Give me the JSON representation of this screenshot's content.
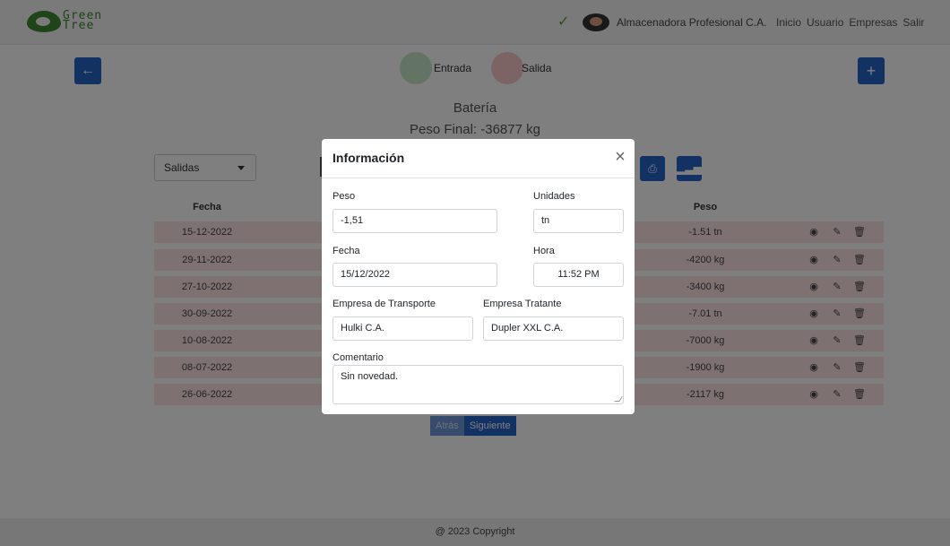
{
  "navbar": {
    "logo_text": "Green Tree",
    "company_name": "Almacenadora Profesional C.A.",
    "links": [
      "Inicio",
      "Usuario",
      "Empresas",
      "Salir"
    ]
  },
  "toolbar": {
    "back_icon": "←",
    "add_icon": "+",
    "legend_entrada": "Entrada",
    "legend_salida": "Salida"
  },
  "product": {
    "name": "Batería",
    "peso_final": "Peso Final: -36877 kg"
  },
  "filter": {
    "selected": "Salidas"
  },
  "table": {
    "headers": {
      "fecha": "Fecha",
      "peso": "Peso"
    },
    "rows": [
      {
        "fecha": "15-12-2022",
        "peso": "-1.51 tn"
      },
      {
        "fecha": "29-11-2022",
        "peso": "-4200 kg"
      },
      {
        "fecha": "27-10-2022",
        "peso": "-3400 kg"
      },
      {
        "fecha": "30-09-2022",
        "peso": "-7.01 tn"
      },
      {
        "fecha": "10-08-2022",
        "peso": "-7000 kg"
      },
      {
        "fecha": "08-07-2022",
        "peso": "-1900 kg"
      },
      {
        "fecha": "26-06-2022",
        "peso": "-2117 kg"
      }
    ]
  },
  "pager": {
    "prev": "Atrás",
    "next": "Siguiente"
  },
  "footer": "@ 2023 Copyright",
  "modal": {
    "title": "Información",
    "close": "×",
    "peso_label": "Peso",
    "peso_value": "-1,51",
    "unidades_label": "Unidades",
    "unidades_value": "tn",
    "fecha_label": "Fecha",
    "fecha_value": "15/12/2022",
    "hora_label": "Hora",
    "hora_value": "11:52 PM",
    "transporte_label": "Empresa de Transporte",
    "transporte_value": "Hulki C.A.",
    "tratante_label": "Empresa Tratante",
    "tratante_value": "Dupler XXL C.A.",
    "comentario_label": "Comentario",
    "comentario_value": "Sin novedad."
  }
}
